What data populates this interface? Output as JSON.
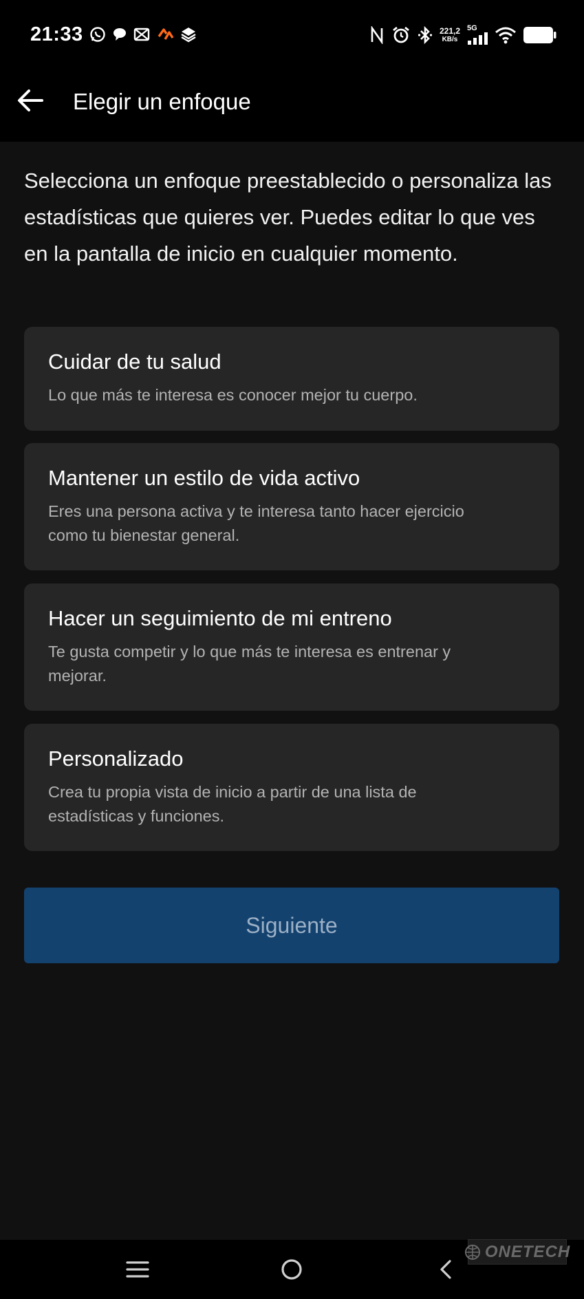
{
  "status_bar": {
    "time": "21:33",
    "left_icons": [
      "whatsapp-icon",
      "chat-bubble-icon",
      "capcut-icon",
      "strava-icon",
      "app-stack-icon"
    ],
    "right_icons": [
      "nfc-icon",
      "alarm-icon",
      "bluetooth-icon",
      "signal-icon",
      "wifi-icon",
      "battery-icon"
    ],
    "net_speed_value": "221,2",
    "net_speed_unit": "KB/s",
    "network_type": "5G"
  },
  "header": {
    "back_icon": "arrow-left-icon",
    "title": "Elegir un enfoque"
  },
  "intro_text": "Selecciona un enfoque preestablecido o personaliza las estadísticas que quieres ver. Puedes editar lo que ves en la pantalla de inicio en cualquier momento.",
  "options": [
    {
      "title": "Cuidar de tu salud",
      "description": "Lo que más te interesa es conocer mejor tu cuerpo."
    },
    {
      "title": "Mantener un estilo de vida activo",
      "description": "Eres una persona activa y te interesa tanto hacer ejercicio como tu bienestar general."
    },
    {
      "title": "Hacer un seguimiento de mi entreno",
      "description": "Te gusta competir y lo que más te interesa es entrenar y mejorar."
    },
    {
      "title": "Personalizado",
      "description": "Crea tu propia vista de inicio a partir de una lista de estadísticas y funciones."
    }
  ],
  "next_button": {
    "label": "Siguiente",
    "background": "#14426f",
    "text_color": "#9bb0c6"
  },
  "nav_bar": {
    "icons": [
      "menu-icon",
      "home-circle-icon",
      "back-chevron-icon"
    ]
  },
  "watermark": {
    "text": "ONETECH"
  },
  "colors": {
    "background": "#111111",
    "card": "#262626",
    "bar": "#000000"
  }
}
